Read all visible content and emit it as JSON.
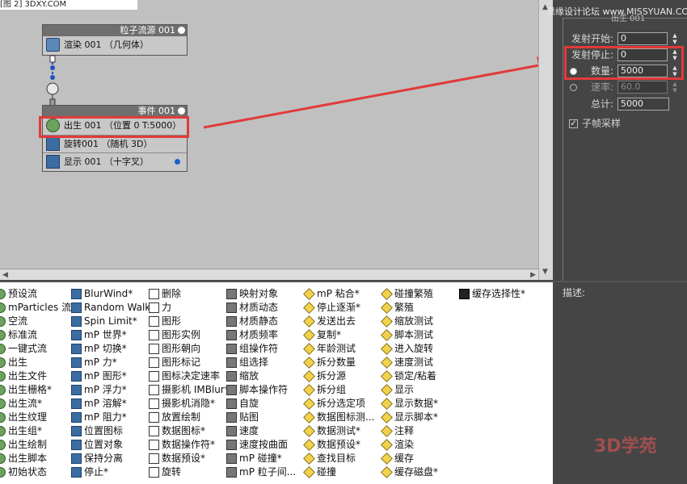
{
  "top_strip": "[图 2]  3DXY.COM",
  "watermark_top": "思缘设计论坛 www.MISSYUAN.COM",
  "watermark_bottom": "3D学苑",
  "colors": {
    "highlight": "#e13a3a",
    "canvas_bg": "#c0c0c0",
    "panel_bg": "#454545"
  },
  "source_node": {
    "title": "粒子流源 001",
    "row": "渲染 001 （几何体）",
    "row_icon": "render-icon"
  },
  "event_node": {
    "title": "事件 001",
    "rows": [
      {
        "label": "出生 001 （位置 0 T:5000）",
        "icon": "birth-icon"
      },
      {
        "label": "旋转001 （随机 3D）",
        "icon": "rotation-icon"
      },
      {
        "label": "显示 001 （十字叉）",
        "icon": "display-icon"
      }
    ]
  },
  "panel": {
    "header_label": "出生 001",
    "emit_start": {
      "label": "发射开始:",
      "value": "0"
    },
    "emit_stop": {
      "label": "发射停止:",
      "value": "0"
    },
    "amount": {
      "label": "数量:",
      "value": "5000"
    },
    "rate": {
      "label": "速率:",
      "value": "60.0"
    },
    "total": {
      "label": "总计:",
      "value": "5000"
    },
    "subframe": {
      "label": "子帧采样",
      "checked": true
    }
  },
  "description_label": "描述:",
  "operators": [
    [
      "预设流",
      "mParticles 流*",
      "空流",
      "标准流",
      "一键式流",
      "出生",
      "出生文件",
      "出生栅格*",
      "出生流*",
      "出生纹理",
      "出生组*",
      "出生绘制",
      "出生脚本",
      "初始状态"
    ],
    [
      "BlurWind*",
      "Random Walk*",
      "Spin Limit*",
      "mP 世界*",
      "mP 切换*",
      "mP 力*",
      "mP 图形*",
      "mP 浮力*",
      "mP 溶解*",
      "mP 阻力*",
      "位置图标",
      "位置对象",
      "保持分离",
      "停止*"
    ],
    [
      "删除",
      "力",
      "图形",
      "图形实例",
      "图形朝向",
      "图形标记",
      "图标决定速率",
      "摄影机 IMBlur*",
      "摄影机消隐*",
      "放置绘制",
      "数据图标*",
      "数据操作符*",
      "数据预设*",
      "旋转"
    ],
    [
      "映射对象",
      "材质动态",
      "材质静态",
      "材质频率",
      "组操作符",
      "组选择",
      "缩放",
      "脚本操作符",
      "自旋",
      "贴图",
      "速度",
      "速度按曲面",
      "mP 碰撞*",
      "mP 粒子间..."
    ],
    [
      "mP 粘合*",
      "停止逐渐*",
      "发送出去",
      "复制*",
      "年龄测试",
      "拆分数量",
      "拆分源",
      "拆分组",
      "拆分选定项",
      "数据图标测...",
      "数据测试*",
      "数据预设*",
      "查找目标",
      "碰撞"
    ],
    [
      "碰撞繁殖",
      "繁殖",
      "缩放测试",
      "脚本测试",
      "进入旋转",
      "速度测试",
      "锁定/粘着",
      "显示",
      "显示数据*",
      "显示脚本*",
      "注释",
      "渲染",
      "缓存",
      "缓存磁盘*"
    ],
    [
      "缓存选择性*"
    ]
  ]
}
